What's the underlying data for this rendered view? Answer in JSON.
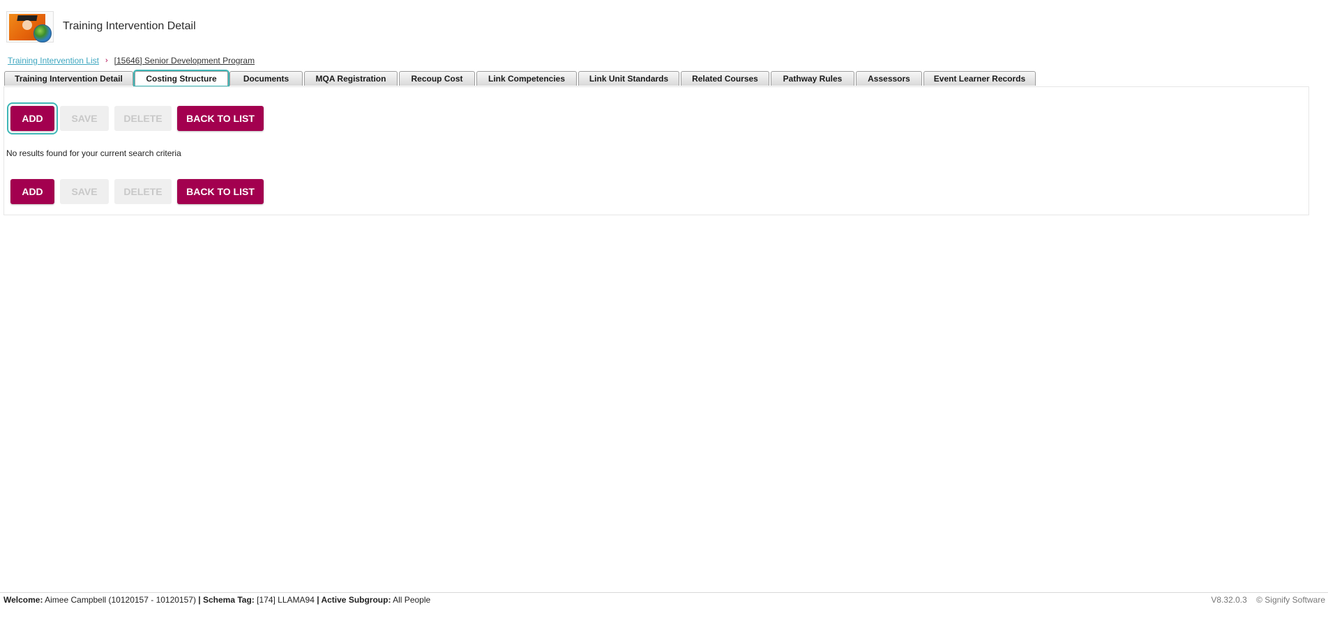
{
  "header": {
    "title": "Training Intervention Detail"
  },
  "breadcrumb": {
    "parent": "Training Intervention List",
    "separator": "›",
    "current": "[15646] Senior Development Program"
  },
  "tabs": [
    {
      "label": "Training Intervention Detail",
      "active": false
    },
    {
      "label": "Costing Structure",
      "active": true
    },
    {
      "label": "Documents",
      "active": false
    },
    {
      "label": "MQA Registration",
      "active": false
    },
    {
      "label": "Recoup Cost",
      "active": false
    },
    {
      "label": "Link Competencies",
      "active": false
    },
    {
      "label": "Link Unit Standards",
      "active": false
    },
    {
      "label": "Related Courses",
      "active": false
    },
    {
      "label": "Pathway Rules",
      "active": false
    },
    {
      "label": "Assessors",
      "active": false
    },
    {
      "label": "Event Learner Records",
      "active": false
    }
  ],
  "toolbar": {
    "add_label": "ADD",
    "save_label": "SAVE",
    "delete_label": "DELETE",
    "back_label": "BACK TO LIST"
  },
  "main": {
    "empty_message": "No results found for your current search criteria"
  },
  "footer": {
    "welcome_label": "Welcome:",
    "welcome_value": "Aimee Campbell (10120157 - 10120157)",
    "schema_label": "| Schema Tag:",
    "schema_value": "[174] LLAMA94",
    "subgroup_label": "| Active Subgroup:",
    "subgroup_value": "All People",
    "version": "V8.32.0.3",
    "copyright": "© Signify Software"
  },
  "colors": {
    "primary_button": "#a3004f",
    "focus_ring": "#3fb7b7",
    "link": "#3fa7c0"
  }
}
